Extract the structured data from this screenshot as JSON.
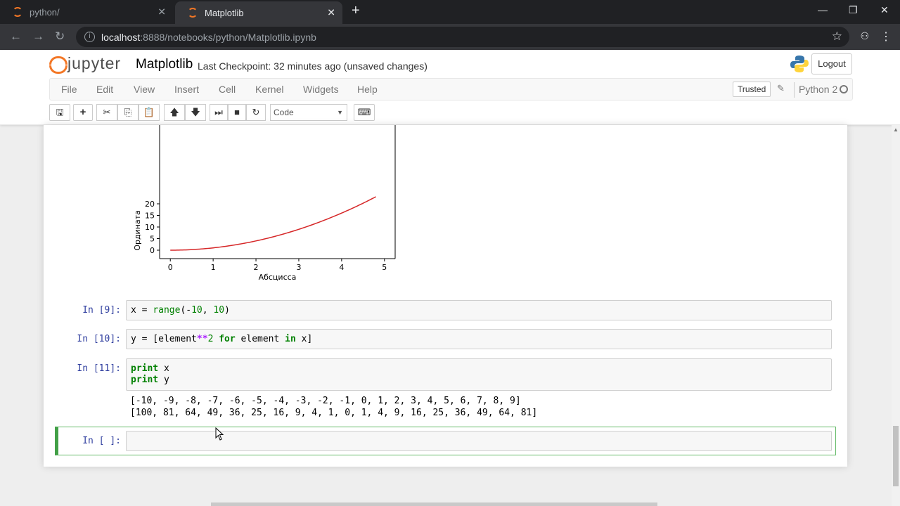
{
  "browser": {
    "tabs": [
      {
        "title": "python/",
        "active": false
      },
      {
        "title": "Matplotlib",
        "active": true
      }
    ],
    "url_host": "localhost",
    "url_rest": ":8888/notebooks/python/Matplotlib.ipynb"
  },
  "jupyter": {
    "brand": "jupyter",
    "notebook_name": "Matplotlib",
    "checkpoint": "Last Checkpoint: 32 minutes ago (unsaved changes)",
    "logout": "Logout",
    "menu": [
      "File",
      "Edit",
      "View",
      "Insert",
      "Cell",
      "Kernel",
      "Widgets",
      "Help"
    ],
    "trusted": "Trusted",
    "kernel": "Python 2",
    "cell_type": "Code",
    "accent": "#f37726"
  },
  "chart_data": {
    "type": "line",
    "xlabel": "Абсцисса",
    "ylabel": "Ордината",
    "xticks": [
      "0",
      "1",
      "2",
      "3",
      "4",
      "5"
    ],
    "yticks": [
      "0",
      "5",
      "10",
      "15",
      "20"
    ],
    "xlim": [
      -0.25,
      5.25
    ],
    "series": [
      {
        "color": "#d62728",
        "function": "y = x^2",
        "x_range": [
          0,
          4.8
        ]
      }
    ]
  },
  "cells": [
    {
      "prompt": "In [9]:",
      "code": "x = range(-10, 10)"
    },
    {
      "prompt": "In [10]:",
      "code": "y = [element**2 for element in x]"
    },
    {
      "prompt": "In [11]:",
      "code": "print x\nprint y",
      "output": "[-10, -9, -8, -7, -6, -5, -4, -3, -2, -1, 0, 1, 2, 3, 4, 5, 6, 7, 8, 9]\n[100, 81, 64, 49, 36, 25, 16, 9, 4, 1, 0, 1, 4, 9, 16, 25, 36, 49, 64, 81]"
    },
    {
      "prompt": "In [ ]:",
      "code": ""
    }
  ]
}
